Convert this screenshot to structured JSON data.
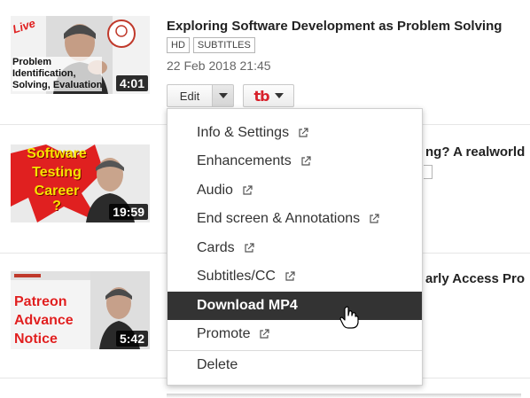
{
  "videos": [
    {
      "title": "Exploring Software Development as Problem Solving",
      "badges": [
        "HD",
        "SUBTITLES"
      ],
      "date": "22 Feb 2018 21:45",
      "duration": "4:01",
      "thumb_live": "Live",
      "thumb_lines": [
        "Problem",
        "Identification,",
        "Solving, Evaluation"
      ]
    },
    {
      "title_partial": "ng? A realworld",
      "duration": "19:59",
      "thumb_lines": [
        "Software",
        "Testing",
        "Career",
        "?"
      ]
    },
    {
      "title_partial": "arly Access Pro",
      "duration": "5:42",
      "thumb_lines": [
        "Patreon",
        "Advance",
        "Notice"
      ]
    }
  ],
  "actions": {
    "edit_label": "Edit",
    "tb_label": "tb"
  },
  "menu": {
    "items": [
      {
        "label": "Info & Settings",
        "external": true
      },
      {
        "label": "Enhancements",
        "external": true
      },
      {
        "label": "Audio",
        "external": true
      },
      {
        "label": "End screen & Annotations",
        "external": true
      },
      {
        "label": "Cards",
        "external": true
      },
      {
        "label": "Subtitles/CC",
        "external": true
      },
      {
        "label": "Download MP4",
        "external": false,
        "highlighted": true
      },
      {
        "label": "Promote",
        "external": true
      },
      {
        "label": "Delete",
        "external": false
      }
    ]
  },
  "colors": {
    "highlight": "#333333",
    "tb_red": "#d8212b",
    "thumb_red": "#e02020",
    "thumb_yellow": "#f6e300"
  }
}
